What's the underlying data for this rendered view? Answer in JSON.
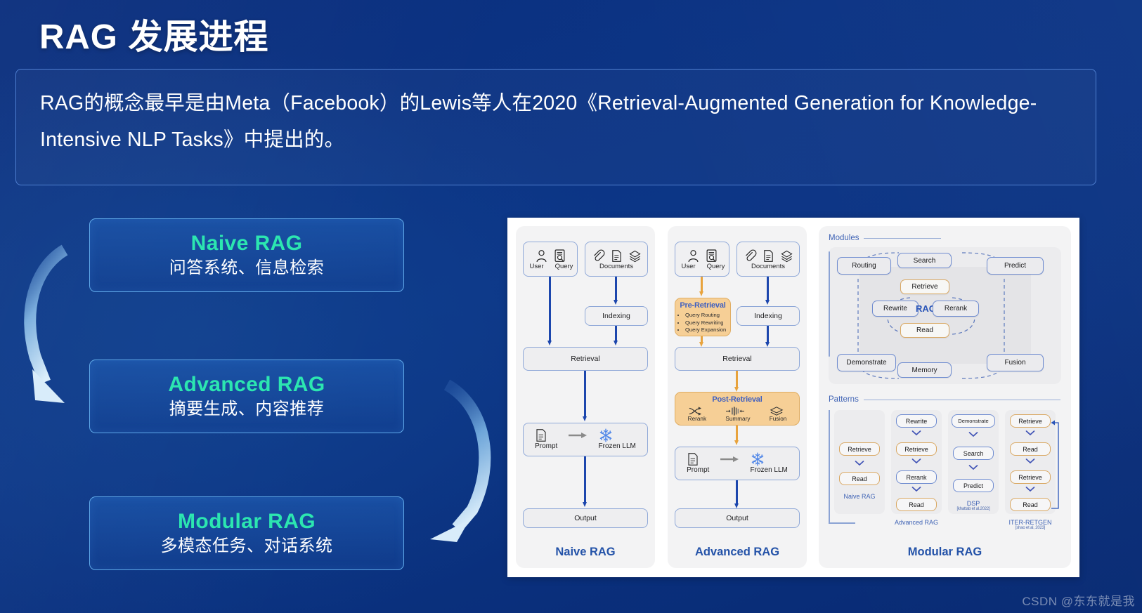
{
  "title": "RAG 发展进程",
  "intro": {
    "text": "RAG的概念最早是由Meta（Facebook）的Lewis等人在2020《Retrieval-Augmented Generation for Knowledge-Intensive NLP Tasks》中提出的。"
  },
  "colors": {
    "background_blue": "#0b3080",
    "accent_green": "#2ce6b0",
    "card_border": "#5fa8e8",
    "panel_white": "#ffffff",
    "node_blue": "#1c46ad",
    "node_orange": "#e8a33d",
    "caption_blue": "#2352a8"
  },
  "stages": [
    {
      "title": "Naive RAG",
      "subtitle": "问答系统、信息检索"
    },
    {
      "title": "Advanced RAG",
      "subtitle": "摘要生成、内容推荐"
    },
    {
      "title": "Modular RAG",
      "subtitle": "多模态任务、对话系统"
    }
  ],
  "diagram": {
    "naive": {
      "caption": "Naive RAG",
      "input_icons": [
        {
          "icon": "user-icon",
          "label": "User"
        },
        {
          "icon": "query-document-search-icon",
          "label": "Query"
        }
      ],
      "documents": {
        "label": "Documents",
        "icons": [
          "paperclip-icon",
          "document-icon",
          "layers-icon"
        ]
      },
      "nodes": [
        "Indexing",
        "Retrieval",
        "Output"
      ],
      "llm_row": {
        "prompt_label": "Prompt",
        "arrow": "right-arrow-icon",
        "llm_label": "Frozen LLM",
        "llm_icon": "snowflake-icon"
      }
    },
    "advanced": {
      "caption": "Advanced RAG",
      "input_icons": [
        {
          "icon": "user-icon",
          "label": "User"
        },
        {
          "icon": "query-document-search-icon",
          "label": "Query"
        }
      ],
      "documents": {
        "label": "Documents",
        "icons": [
          "paperclip-icon",
          "document-icon",
          "layers-icon"
        ]
      },
      "pre_retrieval": {
        "title": "Pre-Retrieval",
        "items": [
          "Query Routing",
          "Query Rewriting",
          "Query Expansion"
        ]
      },
      "post_retrieval": {
        "title": "Post-Retrieval",
        "items": [
          {
            "label": "Rerank",
            "icon": "shuffle-icon"
          },
          {
            "label": "Summary",
            "icon": "compress-icon"
          },
          {
            "label": "Fusion",
            "icon": "stack-fusion-icon"
          }
        ]
      },
      "nodes": [
        "Indexing",
        "Retrieval",
        "Output"
      ],
      "llm_row": {
        "prompt_label": "Prompt",
        "arrow": "right-arrow-icon",
        "llm_label": "Frozen LLM",
        "llm_icon": "snowflake-icon"
      }
    },
    "modular": {
      "caption": "Modular RAG",
      "modules_heading": "Modules",
      "patterns_heading": "Patterns",
      "center_label": "RAG",
      "modules": {
        "top": "Search",
        "top_left": "Routing",
        "top_right": "Predict",
        "bottom_left": "Demonstrate",
        "bottom_right": "Fusion",
        "bottom": "Memory",
        "inner_top": "Retrieve",
        "inner_left": "Rewrite",
        "inner_right": "Rerank",
        "inner_bottom": "Read"
      },
      "patterns": [
        {
          "steps": [
            "Retrieve",
            "Read"
          ],
          "types": [
            "amber",
            "amber"
          ],
          "name": "Naive RAG",
          "cite": ""
        },
        {
          "steps": [
            "Rewrite",
            "Retrieve",
            "Rerank",
            "Read"
          ],
          "types": [
            "blue",
            "amber",
            "blue",
            "amber"
          ],
          "name": "Advanced RAG",
          "cite": ""
        },
        {
          "steps": [
            "Demonstrate",
            "Search",
            "Predict"
          ],
          "types": [
            "blue",
            "blue",
            "blue"
          ],
          "name": "DSP",
          "cite": "[khattab et al.2022]"
        },
        {
          "steps": [
            "Retrieve",
            "Read",
            "Retrieve",
            "Read"
          ],
          "types": [
            "amber",
            "amber",
            "amber",
            "amber"
          ],
          "name": "ITER-RETGEN",
          "cite": "[shao et al, 2023]"
        }
      ]
    }
  },
  "watermark": "CSDN @东东就是我"
}
